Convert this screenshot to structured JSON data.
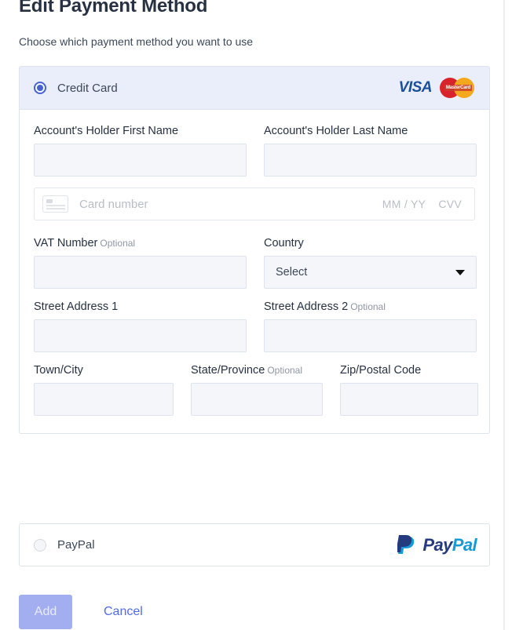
{
  "header": {
    "title": "Edit Payment Method",
    "subtitle": "Choose which payment method you want to use"
  },
  "credit_card": {
    "label": "Credit Card",
    "selected": true,
    "logos": {
      "visa": "VISA",
      "mastercard": "MasterCard"
    },
    "fields": {
      "first_name": {
        "label": "Account's Holder First Name",
        "value": "",
        "placeholder": ""
      },
      "last_name": {
        "label": "Account's Holder Last Name",
        "value": "",
        "placeholder": ""
      },
      "card_number": {
        "placeholder": "Card number",
        "value": ""
      },
      "expiry": {
        "placeholder": "MM / YY",
        "value": ""
      },
      "cvv": {
        "placeholder": "CVV",
        "value": ""
      },
      "vat_number": {
        "label": "VAT Number",
        "optional": "Optional",
        "value": "",
        "placeholder": ""
      },
      "country": {
        "label": "Country",
        "selected_option": "Select"
      },
      "street_address_1": {
        "label": "Street Address 1",
        "value": "",
        "placeholder": ""
      },
      "street_address_2": {
        "label": "Street Address 2",
        "optional": "Optional",
        "value": "",
        "placeholder": ""
      },
      "town_city": {
        "label": "Town/City",
        "value": "",
        "placeholder": ""
      },
      "state_province": {
        "label": "State/Province",
        "optional": "Optional",
        "value": "",
        "placeholder": ""
      },
      "zip_postal_code": {
        "label": "Zip/Postal Code",
        "value": "",
        "placeholder": ""
      }
    }
  },
  "paypal": {
    "label": "PayPal",
    "selected": false,
    "logo_dark": "Pay",
    "logo_light": "Pal"
  },
  "actions": {
    "add_label": "Add",
    "cancel_label": "Cancel"
  },
  "colors": {
    "accent": "#4762d0",
    "header_band": "#eaeefb",
    "input_fill": "#f4f6f9",
    "border": "#dfe3eb",
    "text": "#273142",
    "add_button": "#a3aef0",
    "cancel_link": "#4f6bed",
    "visa_blue": "#1a4f9c",
    "mc_red": "#d8232a",
    "mc_orange": "#f4a81d",
    "paypal_dark": "#253b80",
    "paypal_light": "#179bd7"
  }
}
